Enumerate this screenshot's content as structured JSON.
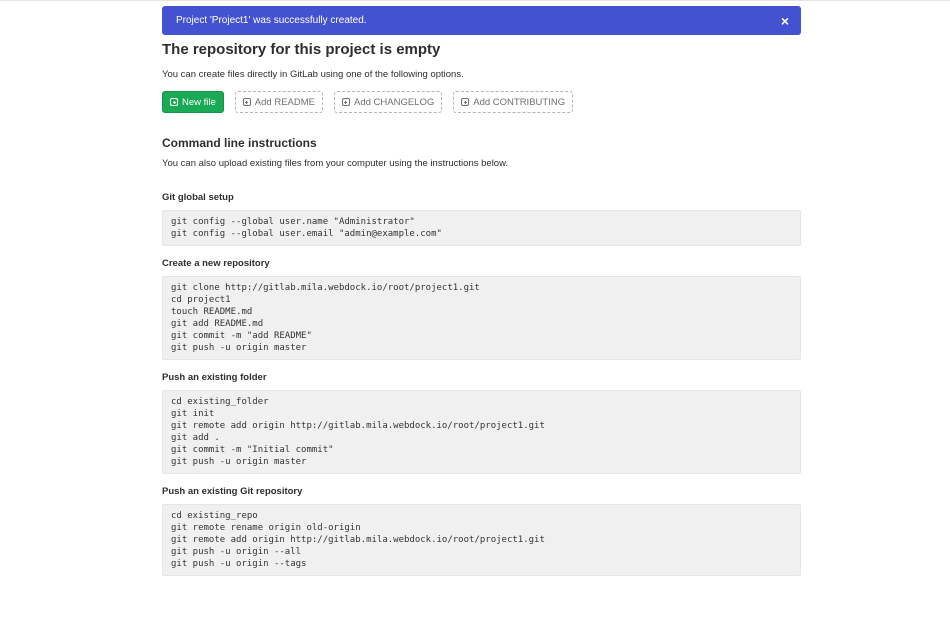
{
  "flash": {
    "message": "Project 'Project1' was successfully created.",
    "close": "×"
  },
  "empty": {
    "title": "The repository for this project is empty",
    "description": "You can create files directly in GitLab using one of the following options."
  },
  "buttons": [
    {
      "label": "New file",
      "icon": "plus-square-icon"
    },
    {
      "label": "Add README",
      "icon": "plus-square-icon"
    },
    {
      "label": "Add CHANGELOG",
      "icon": "plus-square-icon"
    },
    {
      "label": "Add CONTRIBUTING",
      "icon": "plus-square-icon"
    }
  ],
  "cli": {
    "title": "Command line instructions",
    "description": "You can also upload existing files from your computer using the instructions below.",
    "sections": [
      {
        "title": "Git global setup",
        "lines": [
          "git config --global user.name \"Administrator\"",
          "git config --global user.email \"admin@example.com\""
        ]
      },
      {
        "title": "Create a new repository",
        "lines": [
          "git clone http://gitlab.mila.webdock.io/root/project1.git",
          "cd project1",
          "touch README.md",
          "git add README.md",
          "git commit -m \"add README\"",
          "git push -u origin master"
        ]
      },
      {
        "title": "Push an existing folder",
        "lines": [
          "cd existing_folder",
          "git init",
          "git remote add origin http://gitlab.mila.webdock.io/root/project1.git",
          "git add .",
          "git commit -m \"Initial commit\"",
          "git push -u origin master"
        ]
      },
      {
        "title": "Push an existing Git repository",
        "lines": [
          "cd existing_repo",
          "git remote rename origin old-origin",
          "git remote add origin http://gitlab.mila.webdock.io/root/project1.git",
          "git push -u origin --all",
          "git push -u origin --tags"
        ]
      }
    ]
  },
  "colors": {
    "flash_bg": "#4352d1",
    "success": "#1aaa55",
    "code_bg": "#f0f0f0"
  }
}
